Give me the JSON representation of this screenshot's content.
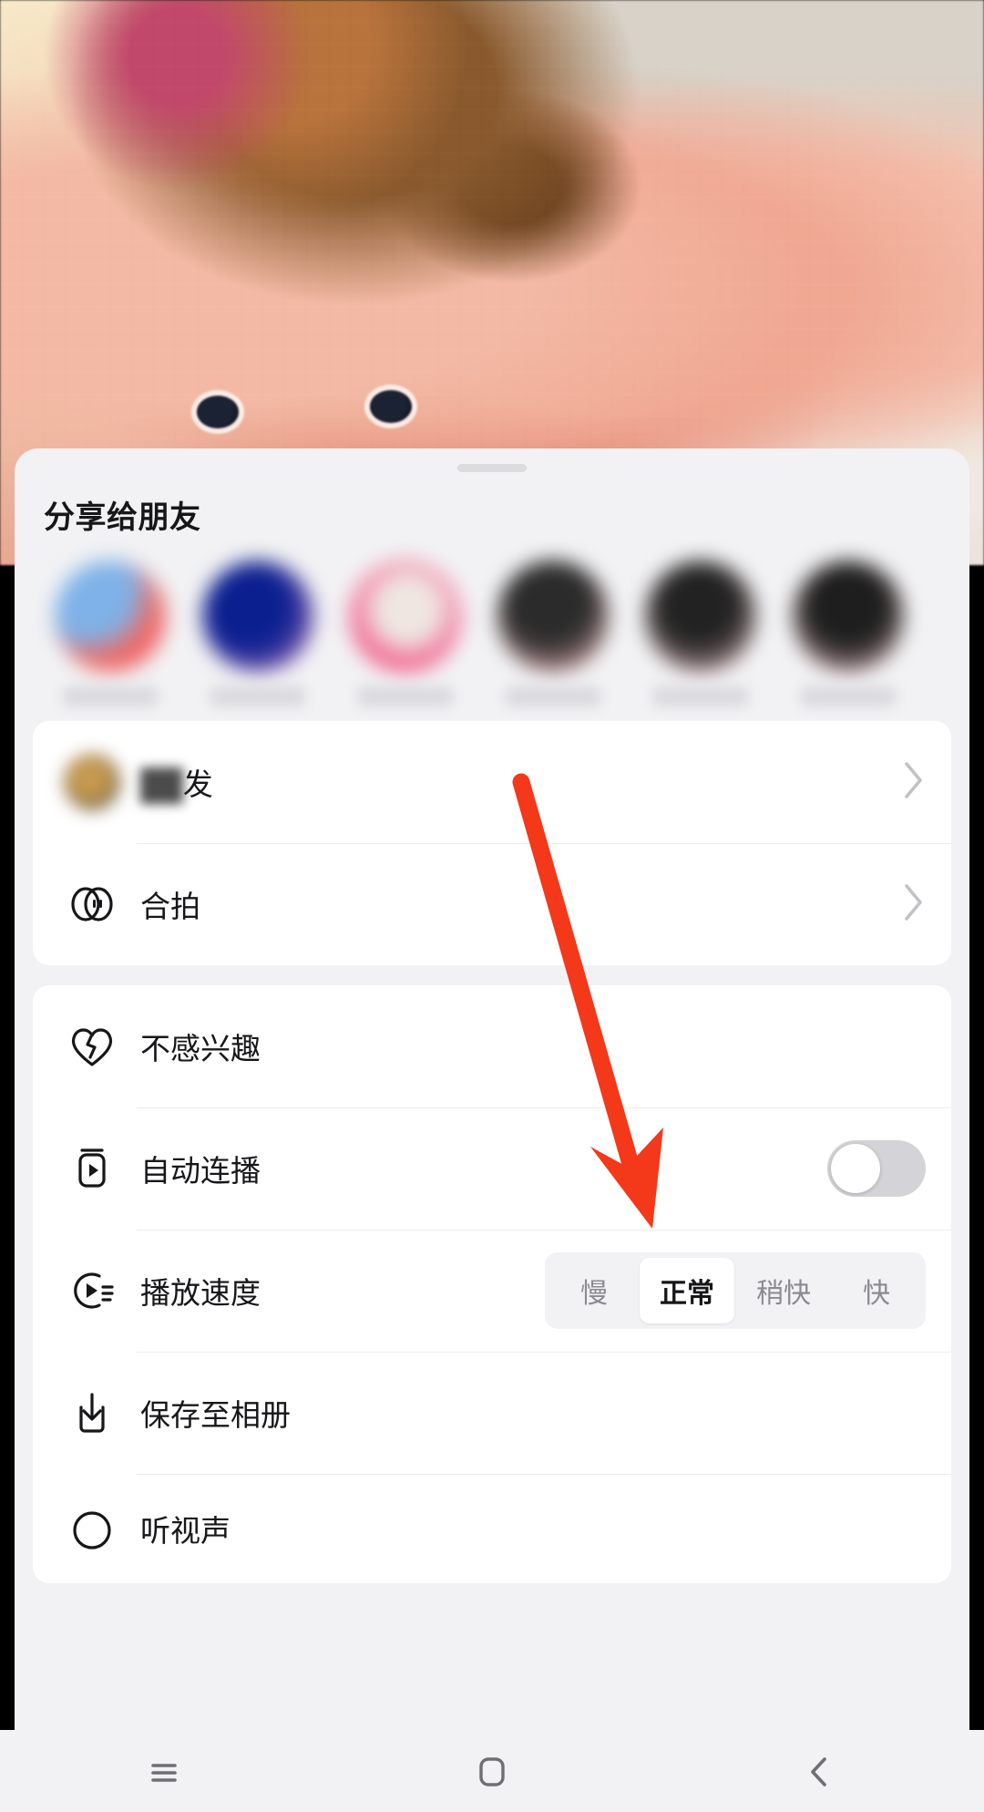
{
  "app": {
    "platform": "android",
    "accent_red": "#f4381a",
    "sheet_bg": "#f2f2f4",
    "card_bg": "#ffffff",
    "text_primary": "#17171a",
    "text_muted": "#8a8a90"
  },
  "sheet": {
    "title": "分享给朋友",
    "grabber": "drag-handle"
  },
  "friends": [
    {
      "name": "",
      "icon": "avatar"
    },
    {
      "name": "",
      "icon": "avatar"
    },
    {
      "name": "",
      "icon": "avatar"
    },
    {
      "name": "",
      "icon": "avatar"
    },
    {
      "name": "",
      "icon": "avatar"
    },
    {
      "name": "",
      "icon": "avatar"
    }
  ],
  "card_actions": {
    "rows": [
      {
        "label": "发",
        "blurred_prefix": "██",
        "icon": "avatar-icon",
        "trailing": "chevron-right"
      },
      {
        "label": "合拍",
        "icon": "duet-icon",
        "trailing": "chevron-right"
      }
    ]
  },
  "card_settings": {
    "rows": [
      {
        "label": "不感兴趣",
        "icon": "broken-heart-icon",
        "trailing": "none"
      },
      {
        "label": "自动连播",
        "icon": "autoplay-icon",
        "trailing": "toggle",
        "toggle_on": false
      },
      {
        "label": "播放速度",
        "icon": "speed-icon",
        "trailing": "segmented"
      },
      {
        "label": "保存至相册",
        "icon": "download-icon",
        "trailing": "none"
      },
      {
        "label": "听视声",
        "icon": "audio-icon",
        "trailing": "none"
      }
    ]
  },
  "speed": {
    "options": [
      "慢",
      "正常",
      "稍快",
      "快"
    ],
    "selected": "正常",
    "selected_index": 1
  },
  "navbar": {
    "buttons": [
      {
        "name": "recents",
        "glyph": "menu-icon"
      },
      {
        "name": "home",
        "glyph": "home-icon"
      },
      {
        "name": "back",
        "glyph": "back-icon"
      }
    ]
  },
  "annotation": {
    "type": "arrow",
    "color": "#f4381a",
    "points_to": "自动连播"
  }
}
